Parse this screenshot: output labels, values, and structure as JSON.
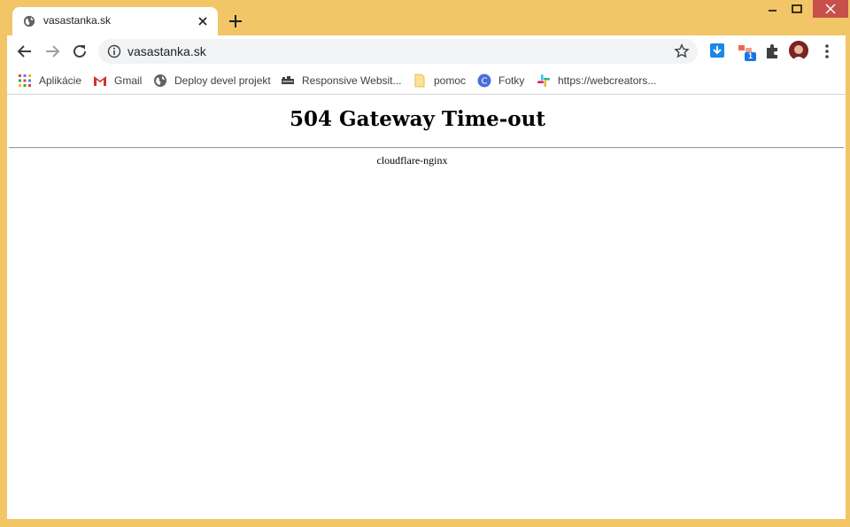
{
  "tab": {
    "title": "vasastanka.sk",
    "icon": "globe-icon"
  },
  "address_bar": {
    "url": "vasastanka.sk"
  },
  "bookmarks": [
    {
      "label": "Aplikácie",
      "icon": "apps-grid-icon"
    },
    {
      "label": "Gmail",
      "icon": "gmail-icon"
    },
    {
      "label": "Deploy devel projekt",
      "icon": "globe-icon"
    },
    {
      "label": "Responsive Websit...",
      "icon": "devices-icon"
    },
    {
      "label": "pomoc",
      "icon": "folder-icon"
    },
    {
      "label": "Fotky",
      "icon": "fotky-icon"
    },
    {
      "label": "https://webcreators...",
      "icon": "slack-icon"
    }
  ],
  "page": {
    "heading": "504 Gateway Time-out",
    "footer": "cloudflare-nginx"
  },
  "extensions": {
    "badge_count": "1"
  },
  "colors": {
    "frame": "#f2c566",
    "close_button": "#c7504a",
    "download_ext": "#1a88e8",
    "badge": "#1a73e8"
  }
}
